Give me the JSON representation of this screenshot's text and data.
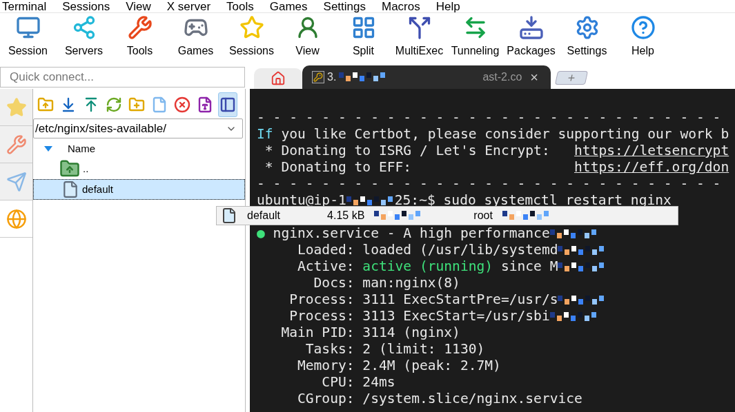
{
  "menu": [
    "Terminal",
    "Sessions",
    "View",
    "X server",
    "Tools",
    "Games",
    "Settings",
    "Macros",
    "Help"
  ],
  "toolbar": [
    {
      "label": "Session",
      "kind": "session"
    },
    {
      "label": "Servers",
      "kind": "servers"
    },
    {
      "label": "Tools",
      "kind": "tools"
    },
    {
      "label": "Games",
      "kind": "games"
    },
    {
      "label": "Sessions",
      "kind": "sessions"
    },
    {
      "label": "View",
      "kind": "view"
    },
    {
      "label": "Split",
      "kind": "split"
    },
    {
      "label": "MultiExec",
      "kind": "multiexec"
    },
    {
      "label": "Tunneling",
      "kind": "tunneling"
    },
    {
      "label": "Packages",
      "kind": "packages"
    },
    {
      "label": "Settings",
      "kind": "settings"
    },
    {
      "label": "Help",
      "kind": "help"
    }
  ],
  "quick_connect": {
    "placeholder": "Quick connect..."
  },
  "side_tabs": [
    {
      "kind": "star",
      "selected": false
    },
    {
      "kind": "tools",
      "selected": false
    },
    {
      "kind": "send",
      "selected": false
    },
    {
      "kind": "globe",
      "selected": true
    }
  ],
  "file_toolbar": [
    {
      "kind": "up",
      "selected": false
    },
    {
      "kind": "download",
      "selected": false
    },
    {
      "kind": "upload",
      "selected": false
    },
    {
      "kind": "refresh",
      "selected": false
    },
    {
      "kind": "newfolder",
      "selected": false
    },
    {
      "kind": "newfile",
      "selected": false
    },
    {
      "kind": "delete",
      "selected": false
    },
    {
      "kind": "rename",
      "selected": false
    },
    {
      "kind": "panel",
      "selected": true
    }
  ],
  "path": "/etc/nginx/sites-available/",
  "tree": {
    "column": "Name",
    "rows": [
      {
        "kind": "parent",
        "name": "..",
        "selected": false
      },
      {
        "kind": "file",
        "name": "default",
        "selected": true
      }
    ]
  },
  "tabs": [
    {
      "kind": "home",
      "selected": false
    },
    {
      "kind": "session",
      "title_start": "3.",
      "title_end": "ast-2.co",
      "selected": true,
      "close": "×"
    }
  ],
  "new_tab": "+",
  "terminal": {
    "lines_above": [
      {
        "segments": [
          {
            "text": "- - - - - - - - - - - - - - - - - - - - - - - - - - - - -",
            "kind": "plain"
          }
        ]
      },
      {
        "segments": [
          {
            "text": "If",
            "kind": "keyword"
          },
          {
            "text": " you like Certbot, please consider supporting our work b",
            "kind": "plain"
          }
        ]
      },
      {
        "segments": [
          {
            "text": " * Donating to ISRG / Let's Encrypt:   ",
            "kind": "plain"
          },
          {
            "text": "https://letsencrypt",
            "kind": "link"
          }
        ]
      },
      {
        "segments": [
          {
            "text": " * Donating to EFF:                    ",
            "kind": "plain"
          },
          {
            "text": "https://eff.org/don",
            "kind": "link"
          }
        ]
      },
      {
        "segments": [
          {
            "text": "- - - - - - - - - - - - - - - - - - - - - - - - - - - - -",
            "kind": "plain"
          }
        ]
      },
      {
        "segments": [
          {
            "text": "ubuntu@ip-1",
            "kind": "plain"
          },
          {
            "kind": "mosaic"
          },
          {
            "text": "25:~$ sudo systemctl restart nginx",
            "kind": "plain"
          }
        ]
      }
    ],
    "lines_below": [
      {
        "segments": [
          {
            "text": "● ",
            "kind": "status"
          },
          {
            "text": "nginx.service - A high performance",
            "kind": "plain"
          },
          {
            "kind": "mosaic"
          }
        ]
      },
      {
        "segments": [
          {
            "text": "     Loaded: loaded (/usr/lib/systemd",
            "kind": "plain"
          },
          {
            "kind": "mosaic"
          }
        ]
      },
      {
        "segments": [
          {
            "text": "     Active: ",
            "kind": "plain"
          },
          {
            "text": "active (running)",
            "kind": "status"
          },
          {
            "text": " since M",
            "kind": "plain"
          },
          {
            "kind": "mosaic"
          }
        ]
      },
      {
        "segments": [
          {
            "text": "       Docs: man:nginx(8)",
            "kind": "plain"
          }
        ]
      },
      {
        "segments": [
          {
            "text": "    Process: 3111 ExecStartPre=/usr/s",
            "kind": "plain"
          },
          {
            "kind": "mosaic"
          }
        ]
      },
      {
        "segments": [
          {
            "text": "    Process: 3113 ExecStart=/usr/sbi",
            "kind": "plain"
          },
          {
            "kind": "mosaic"
          }
        ]
      },
      {
        "segments": [
          {
            "text": "   Main PID: 3114 (nginx)",
            "kind": "plain"
          }
        ]
      },
      {
        "segments": [
          {
            "text": "      Tasks: 2 (limit: 1130)",
            "kind": "plain"
          }
        ]
      },
      {
        "segments": [
          {
            "text": "     Memory: 2.4M (peak: 2.7M)",
            "kind": "plain"
          }
        ]
      },
      {
        "segments": [
          {
            "text": "        CPU: 24ms",
            "kind": "plain"
          }
        ]
      },
      {
        "segments": [
          {
            "text": "     CGroup: /system.slice/nginx.service",
            "kind": "plain"
          }
        ]
      }
    ]
  },
  "tooltip": {
    "name": "default",
    "size": "4.15 kB",
    "owner": "root"
  }
}
